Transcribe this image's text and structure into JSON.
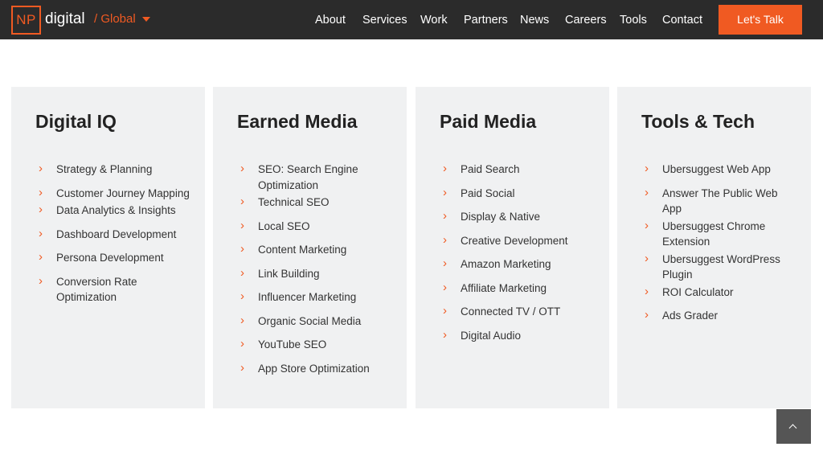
{
  "header": {
    "logo_mark": "NP",
    "logo_word": "digital",
    "region": "/ Global",
    "nav": [
      "About",
      "Services",
      "Work",
      "Partners",
      "News",
      "Careers",
      "Tools",
      "Contact"
    ],
    "cta": "Let's Talk",
    "accent_color": "#f05a22"
  },
  "columns": [
    {
      "title": "Digital IQ",
      "items": [
        "Strategy & Planning",
        "Customer Journey Mapping",
        "Data Analytics & Insights",
        "Dashboard Development",
        "Persona Development",
        "Conversion Rate Optimization"
      ]
    },
    {
      "title": "Earned Media",
      "items": [
        "SEO: Search Engine Optimization",
        "Technical SEO",
        "Local SEO",
        "Content Marketing",
        "Link Building",
        "Influencer Marketing",
        "Organic Social Media",
        "YouTube SEO",
        "App Store Optimization"
      ]
    },
    {
      "title": "Paid Media",
      "items": [
        "Paid Search",
        "Paid Social",
        "Display & Native",
        "Creative Development",
        "Amazon Marketing",
        "Affiliate Marketing",
        "Connected TV / OTT",
        "Digital Audio"
      ]
    },
    {
      "title": "Tools & Tech",
      "items": [
        "Ubersuggest Web App",
        "Answer The Public Web App",
        "Ubersuggest Chrome Extension",
        "Ubersuggest WordPress Plugin",
        "ROI Calculator",
        "Ads Grader"
      ]
    }
  ],
  "icons": {
    "bullet": "chevron-right-icon",
    "back_to_top": "chevron-up-icon"
  }
}
